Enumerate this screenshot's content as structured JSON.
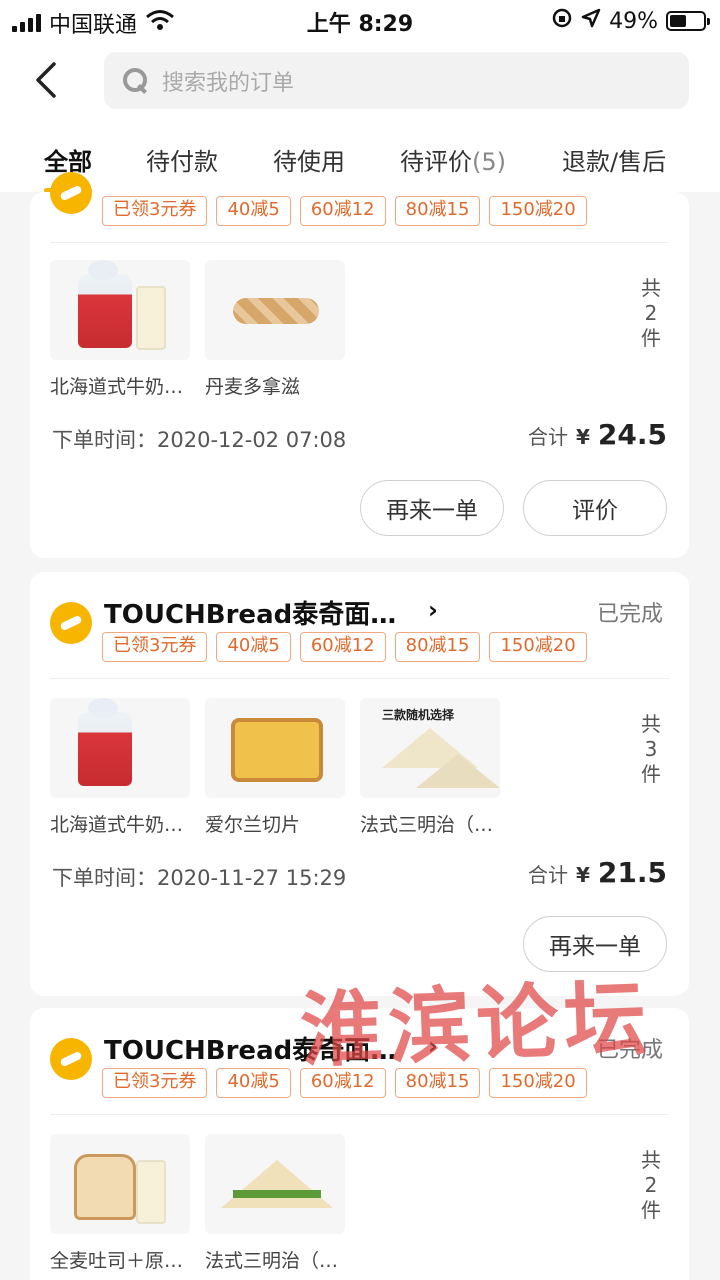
{
  "status_bar": {
    "carrier": "中国联通",
    "time": "上午 8:29",
    "battery": "49%",
    "battery_level": 0.49
  },
  "search": {
    "placeholder": "搜索我的订单"
  },
  "tabs": [
    {
      "label": "全部"
    },
    {
      "label": "待付款"
    },
    {
      "label": "待使用"
    },
    {
      "label": "待评价",
      "count": "(5)"
    },
    {
      "label": "退款/售后"
    }
  ],
  "coupons": [
    "已领3元券",
    "40减5",
    "60减12",
    "80减15",
    "150减20"
  ],
  "orders": [
    {
      "products": [
        "北海道式牛奶…",
        "丹麦多拿滋"
      ],
      "count_chars": [
        "共",
        "2",
        "件"
      ],
      "time": "下单时间：2020-12-02 07:08",
      "total_label": "合计",
      "currency": "¥",
      "total": "24.5",
      "buttons": [
        "再来一单",
        "评价"
      ]
    },
    {
      "shop": "TOUCHBread泰奇面…",
      "shop_status": "已完成",
      "products": [
        "北海道式牛奶…",
        "爱尔兰切片",
        "法式三明治（…"
      ],
      "product_img_text": "三款随机选择",
      "count_chars": [
        "共",
        "3",
        "件"
      ],
      "time": "下单时间：2020-11-27 15:29",
      "total_label": "合计",
      "currency": "¥",
      "total": "21.5",
      "buttons": [
        "再来一单"
      ]
    },
    {
      "shop": "TOUCHBread泰奇面…",
      "shop_status": "已完成",
      "products": [
        "全麦吐司＋原…",
        "法式三明治（…"
      ],
      "count_chars": [
        "共",
        "2",
        "件"
      ]
    }
  ],
  "watermark": "淮滨论坛",
  "colors": {
    "accent": "#f7b500",
    "coupon": "#e06a2c"
  }
}
